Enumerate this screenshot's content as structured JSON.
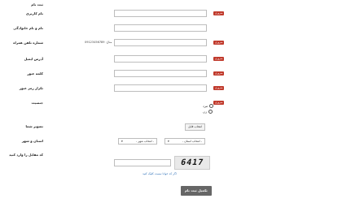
{
  "form": {
    "heading": "ثبت نام",
    "required_badge": "ضروری",
    "fields": [
      {
        "label": "نام کاربری",
        "required": true
      },
      {
        "label": "نام و نام خانوادگی",
        "required": false
      },
      {
        "label": "شماره تلفن همراه",
        "required": true,
        "hint": "مثال: 09123456789"
      },
      {
        "label": "آدرس ایمیل",
        "required": true
      },
      {
        "label": "کلمه عبور",
        "required": true
      },
      {
        "label": "تکرار رمز عبور",
        "required": true
      }
    ],
    "gender": {
      "label": "جنسیت",
      "options": [
        "مرد",
        "زن"
      ]
    },
    "avatar": {
      "label": "تصویر شما",
      "button": "انتخاب فایل"
    },
    "location": {
      "label": "استان و شهر",
      "province_placeholder": "- انتخاب استان -",
      "city_placeholder": "- انتخاب شهر -"
    },
    "captcha": {
      "label": "کد مقابل را وارد کنید",
      "code": "6417",
      "refresh_link": "اگر کد خوانا نیست کلیک کنید"
    },
    "submit_label": "تکمیل ثبت نام"
  }
}
